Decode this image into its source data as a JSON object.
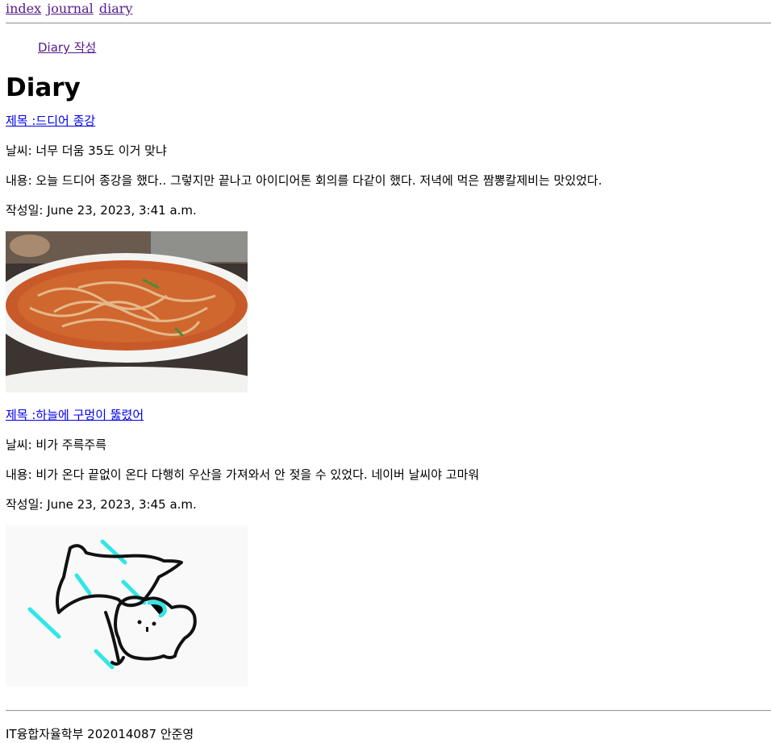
{
  "nav": {
    "links": [
      "index",
      "journal",
      "diary"
    ]
  },
  "sub_link": "Diary 작성",
  "page_title": "Diary",
  "entries": [
    {
      "title": "제목 :드디어 종강",
      "weather": "날씨: 너무 더움 35도 이거 맞냐",
      "content": "내용: 오늘 드디어 종강을 했다.. 그렇지만 끝나고 아이디어톤 회의를 다같이 했다. 저녁에 먹은 짬뽕칼제비는 맛있었다.",
      "date": "작성일: June 23, 2023, 3:41 a.m."
    },
    {
      "title": "제목 :하늘에 구멍이 뚫렸어",
      "weather": "날씨: 비가 주륵주륵",
      "content": "내용: 비가 온다 끝없이 온다 다행히 우산을 가져와서 안 젖을 수 있었다. 네이버 날씨야 고마워",
      "date": "작성일: June 23, 2023, 3:45 a.m."
    }
  ],
  "footer": "IT융합자율학부 202014087 안준영",
  "colors": {
    "visited_link": "#551a8b",
    "link": "#0000ee"
  }
}
